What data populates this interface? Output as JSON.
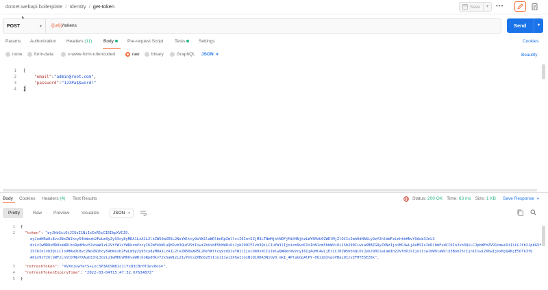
{
  "breadcrumb": [
    "dotnet.webapi.boilerplate",
    "Identity",
    "get-token"
  ],
  "toolbar": {
    "save_label": "Save",
    "more_label": "•••"
  },
  "request": {
    "method": "POST",
    "url_var": "{{url}}",
    "url_path": "/tokens",
    "send_label": "Send"
  },
  "tabs": {
    "params": "Params",
    "authorization": "Authorization",
    "headers": "Headers",
    "headers_count": "(11)",
    "body": "Body",
    "prerequest": "Pre-request Script",
    "tests": "Tests",
    "settings": "Settings",
    "cookies": "Cookies"
  },
  "body_types": {
    "none": "none",
    "form_data": "form-data",
    "urlencoded": "x-www-form-urlencoded",
    "raw": "raw",
    "binary": "binary",
    "graphql": "GraphQL",
    "format": "JSON",
    "beautify": "Beautify"
  },
  "editor": {
    "line_numbers": [
      "1",
      "2",
      "3",
      "4"
    ],
    "line1": "{",
    "email_key": "\"email\"",
    "email_value": "\"admin@root.com\"",
    "password_key": "\"password\"",
    "password_value": "\"123Pa$$word!\"",
    "line4": "}"
  },
  "response": {
    "tabs": {
      "body": "Body",
      "cookies": "Cookies",
      "headers": "Headers",
      "headers_count": "(4)",
      "test_results": "Test Results"
    },
    "status_label": "Status:",
    "status_value": "200 OK",
    "time_label": "Time:",
    "time_value": "63 ms",
    "size_label": "Size:",
    "size_value": "1 KB",
    "save_response": "Save Response",
    "views": {
      "pretty": "Pretty",
      "raw": "Raw",
      "preview": "Preview",
      "visualize": "Visualize",
      "format": "JSON"
    },
    "line_numbers": [
      "1",
      "2",
      "3",
      "4",
      "5"
    ],
    "line1": "{",
    "token_key": "\"token\"",
    "token_lines": [
      "\"eyJhbGciOiJIUzI1NiIsInR5cCI6IkpXVCJ9.",
      "eyJodHRwOi8vc2NoZW1hcy54bWxzb2FwLm9yZy93cy8yMDA1LzA1L2lkZW50aXR5L2NsYWltcy9uYW1laWRlbnRpZmllciI6IntSZjM3LTNmMjktNDFjMi04NjkzLWY5MzU0ZWRlMjZlOCIsImh0dHA6Ly9zY2hlbWFzLnhtbHNvYXAub3JnL3",
      "dzLzIwMDUvMDUvaWRlbnRpdHkvY2xhaW1zL2VtYWlsYWRkcmVzcyI6ImFkbWluQHJvb3QuY29tIiwiZnVsbE5hbWUiOiJyb290IFJvb3QiLCJuYW1lIjoicm9vdCIsInN1cm5hbWUiOiJSb290IiwiaXBBZGRyZXNzIjoiMC4wLjAuMSIsInRlbmFudCI6InJvb3QiLCJpbWFnZV91cmwiOiIiLCJtb2JpbGVfcGhvbmUiOiIiLCJleHAiOjE2NDgz",
      "ZSI6InJvb3QiLCJodHRwOi8vc2NoZW1hcy54bWxzb2FwLm9yZy93cy8yMDA1LzA1L2lkZW50aXR5L2NsYWltcy9zdXJuYW1lIjoiUm9vdCIsImlwQWRkcmVzcyI6IjAuMC4wLjEiLCJ0ZW5hbnQiOiJyb290IiwiaW1hZ2VfdXJsIjoiIiwibW9iaWxlX3Bob25lIjoiIiwiZXhwIjoxNjQ4NjE5OTk3fQ",
      "A6Ly9zY2hlbWFzLnhtbHNvYXAub3JnL3dzLzIwMDUvMDUvaWRlbnRpdHkvY2xhaW1zL21vYmlsZXBob25lIjoiIiwiZXhwIjoxNjQ1ODA3NjUy0.mkI_4PlaUopAlPY-0QiZm3vpoVBaLOIzvZFHTESEZ6k\","
    ],
    "refresh_token_key": "\"refreshToken\"",
    "refresh_token_value": "\"XVXnJuwYetS+Lxc3P3AISW81c1lYx83CBr0TIev0oo=\",",
    "refresh_expiry_key": "\"refreshTokenExpiryTime\"",
    "refresh_expiry_value": "\"2022-03-04T15:47:32.6763487Z\"",
    "line5": "}"
  },
  "colors": {
    "accent": "#f26b3a",
    "send": "#1a73e8",
    "success": "#26b47f",
    "json_key": "#b0372e",
    "json_string": "#1a4ed1"
  }
}
